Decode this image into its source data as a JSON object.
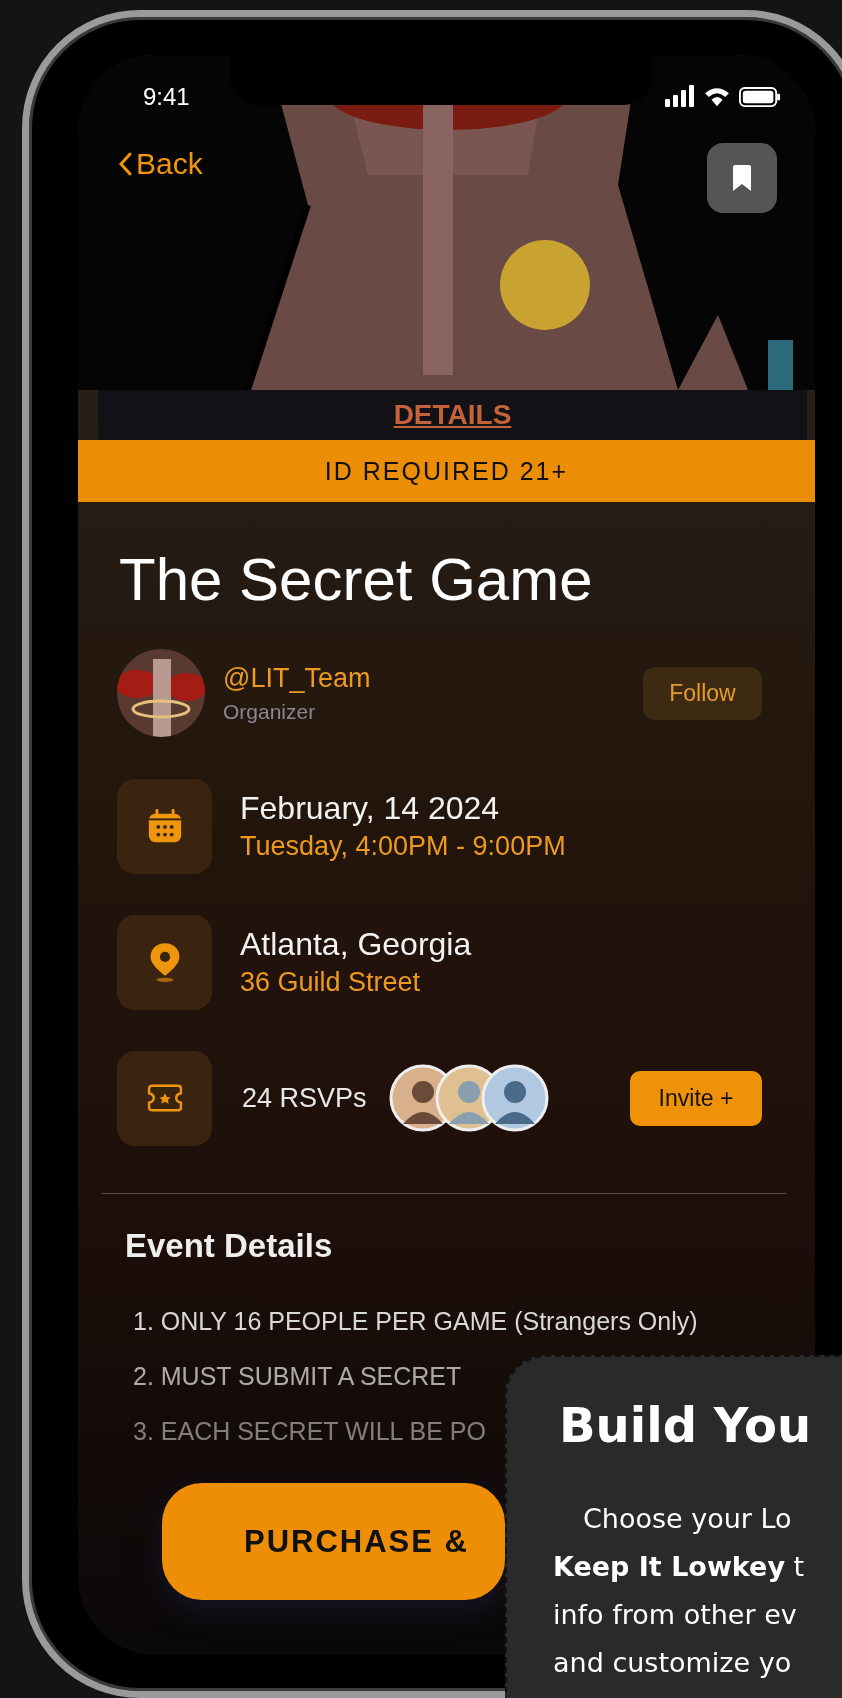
{
  "status_bar": {
    "time": "9:41"
  },
  "nav": {
    "back": "Back"
  },
  "details_tab": "DETAILS",
  "age_banner": "ID REQUIRED 21+",
  "event": {
    "title": "The Secret Game"
  },
  "organizer": {
    "handle": "@LIT_Team",
    "role": "Organizer",
    "follow": "Follow"
  },
  "info_rows": [
    {
      "kind": "date",
      "primary": "February, 14 2024",
      "secondary": "Tuesday, 4:00PM - 9:00PM"
    },
    {
      "kind": "location",
      "primary": "Atlanta, Georgia",
      "secondary": "36 Guild Street"
    },
    {
      "kind": "rsvp",
      "primary": "24 RSVPs",
      "action": "Invite +"
    }
  ],
  "event_details": {
    "heading": "Event Details",
    "items": [
      "1. ONLY 16 PEOPLE PER GAME (Strangers Only)",
      "2. MUST SUBMIT A SECRET",
      "3. EACH SECRET WILL BE PO"
    ]
  },
  "purchase_button": "PURCHASE &",
  "promo_card": {
    "title": "Build You",
    "body": "Choose your Lo\n**Keep It Lowkey** t\ninfo from other ev\nand customize yo"
  }
}
